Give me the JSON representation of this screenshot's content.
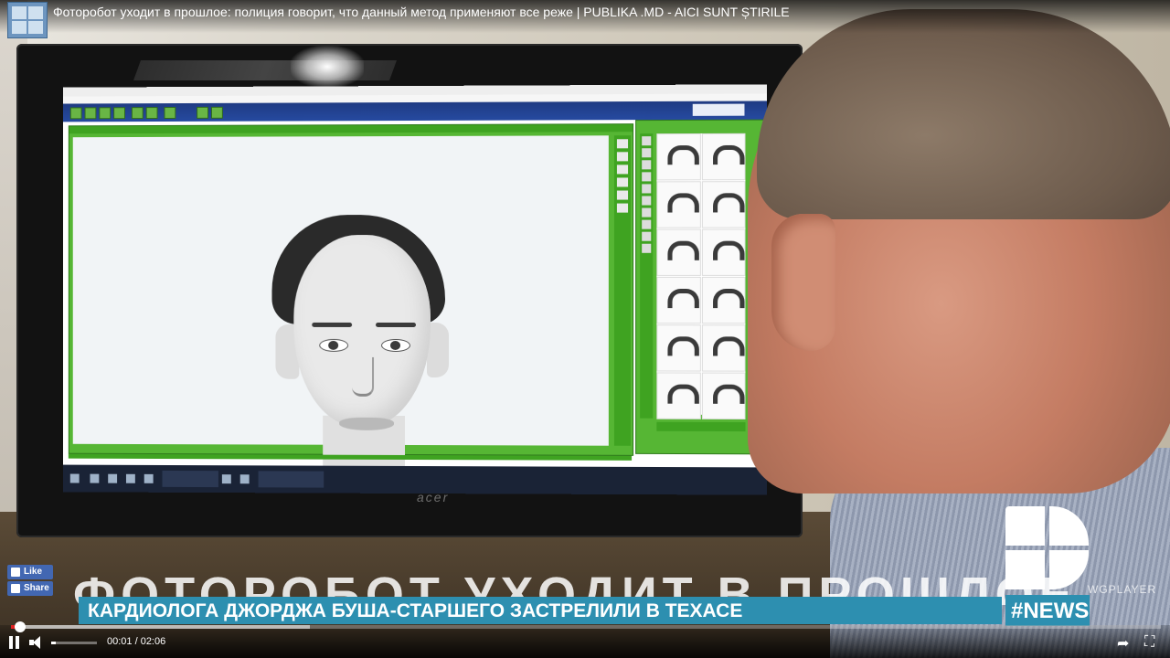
{
  "video": {
    "title": "Фоторобот уходит в прошлое: полиция говорит, что данный метод применяют все реже | PUBLIKA .MD - AICI SUNT ȘTIRILE",
    "big_caption": "ФОТОРОБОТ УХОДИТ В ПРОШЛОЕ",
    "ticker": "КАРДИОЛОГА ДЖОРДЖА БУША-СТАРШЕГО ЗАСТРЕЛИЛИ В ТЕХАСЕ",
    "news_tag": "#NEWS",
    "player_brand": "WGPLAYER",
    "monitor_brand": "acer"
  },
  "social": {
    "like_label": "Like",
    "share_label": "Share"
  },
  "player": {
    "time_display": "00:01 / 02:06",
    "progress_fraction": 0.008,
    "buffer_fraction": 0.26,
    "volume_fraction": 0.1,
    "accent_color": "#e02020"
  },
  "icons": {
    "pause": "pause-icon",
    "volume": "volume-icon",
    "share": "share-icon",
    "fullscreen": "fullscreen-icon",
    "facebook": "facebook-icon"
  },
  "colors": {
    "ticker_bg": "#2d8fb0",
    "facebook_blue": "#4267b2"
  }
}
